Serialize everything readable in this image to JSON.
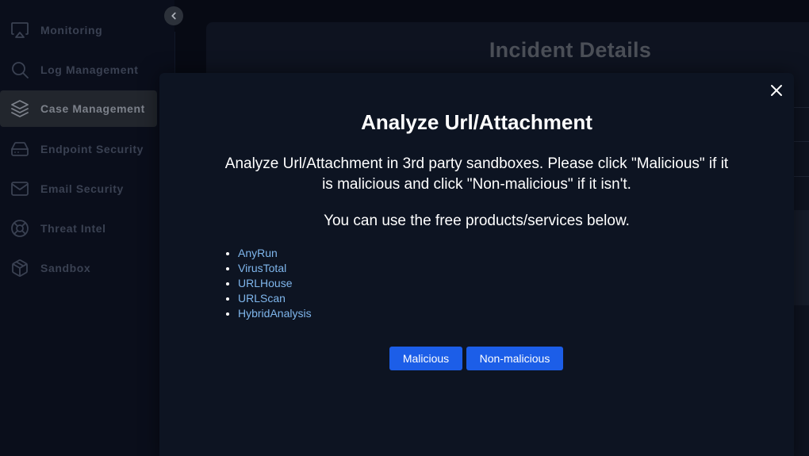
{
  "sidebar": {
    "items": [
      {
        "label": "Monitoring",
        "icon": "monitor-icon"
      },
      {
        "label": "Log Management",
        "icon": "search-icon"
      },
      {
        "label": "Case Management",
        "icon": "layers-icon",
        "active": true
      },
      {
        "label": "Endpoint Security",
        "icon": "hard-drive-icon"
      },
      {
        "label": "Email Security",
        "icon": "mail-icon"
      },
      {
        "label": "Threat Intel",
        "icon": "lifebuoy-icon"
      },
      {
        "label": "Sandbox",
        "icon": "box-icon"
      }
    ]
  },
  "background": {
    "title": "Incident Details"
  },
  "modal": {
    "title": "Analyze Url/Attachment",
    "description": "Analyze Url/Attachment in 3rd party sandboxes. Please click \"Malicious\" if it is malicious and click \"Non-malicious\" if it isn't.",
    "subtext": "You can use the free products/services below.",
    "services": [
      "AnyRun",
      "VirusTotal",
      "URLHouse",
      "URLScan",
      "HybridAnalysis"
    ],
    "buttons": {
      "malicious": "Malicious",
      "non_malicious": "Non-malicious"
    }
  },
  "colors": {
    "accent": "#1c5ee8",
    "link": "#7fb6ec",
    "modal_bg": "#0d1422",
    "page_bg": "#070a14"
  }
}
